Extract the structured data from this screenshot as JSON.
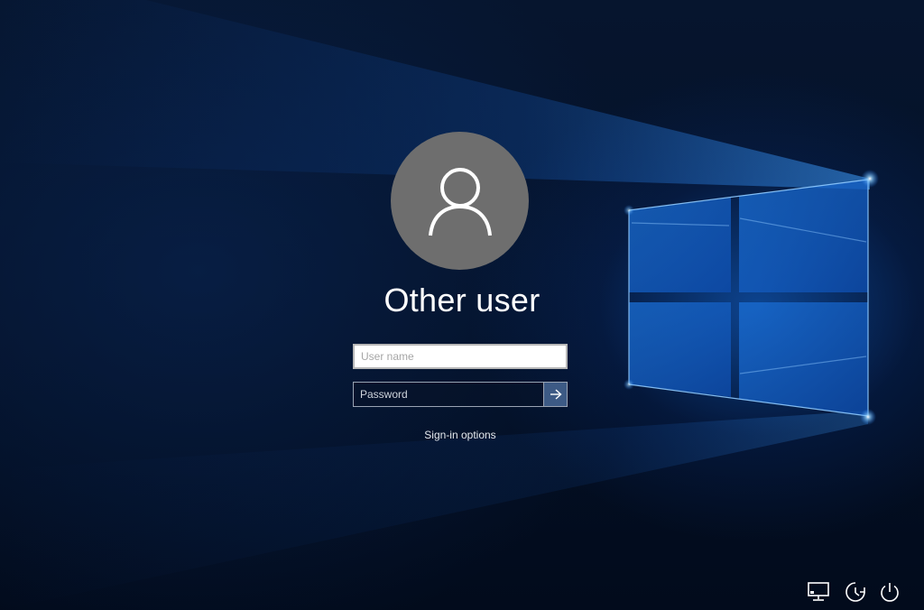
{
  "login": {
    "user_display_name": "Other user",
    "username_field": {
      "placeholder": "User name",
      "value": ""
    },
    "password_field": {
      "placeholder": "Password",
      "value": ""
    },
    "sign_in_options_label": "Sign-in options"
  },
  "icons": {
    "avatar": "user-silhouette-icon",
    "submit": "arrow-right-icon",
    "network": "network-icon",
    "ease_of_access": "ease-of-access-icon",
    "power": "power-icon"
  },
  "colors": {
    "background": "#041127",
    "glow": "#1e7cf0",
    "avatar_bg": "#6e6e6e",
    "submit_button": "#3d5a85",
    "text": "#ffffff"
  }
}
